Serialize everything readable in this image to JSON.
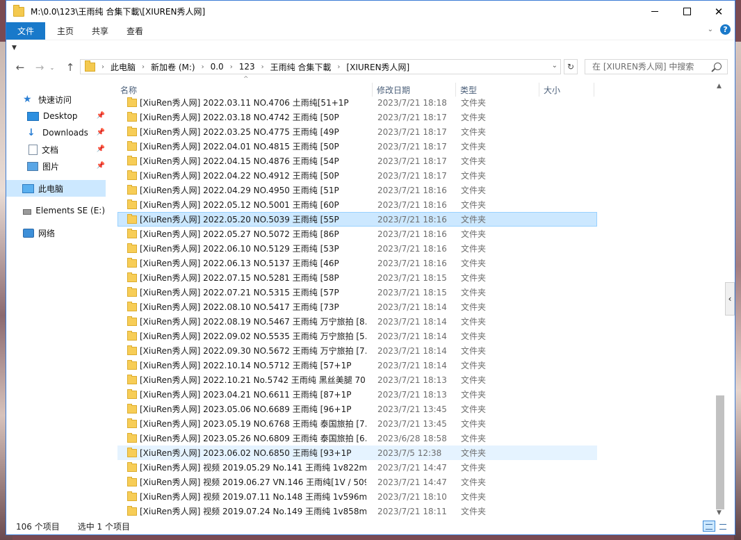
{
  "window": {
    "title": "M:\\0.0\\123\\王雨纯 合集下載\\[XIUREN秀人网]"
  },
  "ribbon": {
    "tabs": [
      "文件",
      "主页",
      "共享",
      "查看"
    ]
  },
  "address": {
    "crumbs": [
      "此电脑",
      "新加卷 (M:)",
      "0.0",
      "123",
      "王雨纯 合集下載",
      "[XIUREN秀人网]"
    ]
  },
  "search": {
    "placeholder": "在 [XIUREN秀人网] 中搜索"
  },
  "nav": {
    "items": [
      {
        "label": "快速访问",
        "icon": "star-icon",
        "pinned": false
      },
      {
        "label": "Desktop",
        "icon": "desktop-icon",
        "pinned": true
      },
      {
        "label": "Downloads",
        "icon": "download-icon",
        "pinned": true
      },
      {
        "label": "文档",
        "icon": "document-icon",
        "pinned": true
      },
      {
        "label": "图片",
        "icon": "picture-icon",
        "pinned": true
      },
      {
        "label": "此电脑",
        "icon": "computer-icon",
        "pinned": false
      },
      {
        "label": "Elements SE (E:)",
        "icon": "drive-icon",
        "pinned": false
      },
      {
        "label": "网络",
        "icon": "network-icon",
        "pinned": false
      }
    ]
  },
  "columns": {
    "name": "名称",
    "date": "修改日期",
    "type": "类型",
    "size": "大小"
  },
  "files": [
    {
      "name": "[XiuRen秀人网] 2022.03.11 NO.4706 土雨纯[51+1P",
      "date": "2023/7/21 18:18",
      "type": "文件夹"
    },
    {
      "name": "[XiuRen秀人网] 2022.03.18 NO.4742 王雨纯 [50P",
      "date": "2023/7/21 18:17",
      "type": "文件夹"
    },
    {
      "name": "[XiuRen秀人网] 2022.03.25 NO.4775 王雨纯 [49P",
      "date": "2023/7/21 18:17",
      "type": "文件夹"
    },
    {
      "name": "[XiuRen秀人网] 2022.04.01 NO.4815 王雨纯 [50P",
      "date": "2023/7/21 18:17",
      "type": "文件夹"
    },
    {
      "name": "[XiuRen秀人网] 2022.04.15 NO.4876 王雨纯 [54P",
      "date": "2023/7/21 18:17",
      "type": "文件夹"
    },
    {
      "name": "[XiuRen秀人网] 2022.04.22 NO.4912 王雨纯 [50P",
      "date": "2023/7/21 18:17",
      "type": "文件夹"
    },
    {
      "name": "[XiuRen秀人网] 2022.04.29 NO.4950 王雨纯 [51P",
      "date": "2023/7/21 18:16",
      "type": "文件夹"
    },
    {
      "name": "[XiuRen秀人网] 2022.05.12 NO.5001 王雨纯 [60P",
      "date": "2023/7/21 18:16",
      "type": "文件夹"
    },
    {
      "name": "[XiuRen秀人网] 2022.05.20 NO.5039 王雨纯 [55P",
      "date": "2023/7/21 18:16",
      "type": "文件夹"
    },
    {
      "name": "[XiuRen秀人网] 2022.05.27 NO.5072 王雨纯 [86P",
      "date": "2023/7/21 18:16",
      "type": "文件夹"
    },
    {
      "name": "[XiuRen秀人网] 2022.06.10 NO.5129 王雨纯 [53P",
      "date": "2023/7/21 18:16",
      "type": "文件夹"
    },
    {
      "name": "[XiuRen秀人网] 2022.06.13 NO.5137 王雨纯 [46P",
      "date": "2023/7/21 18:16",
      "type": "文件夹"
    },
    {
      "name": "[XiuRen秀人网] 2022.07.15 NO.5281 王雨纯 [58P",
      "date": "2023/7/21 18:15",
      "type": "文件夹"
    },
    {
      "name": "[XiuRen秀人网] 2022.07.21 NO.5315 王雨纯 [57P",
      "date": "2023/7/21 18:15",
      "type": "文件夹"
    },
    {
      "name": "[XiuRen秀人网] 2022.08.10 NO.5417 王雨纯 [73P",
      "date": "2023/7/21 18:14",
      "type": "文件夹"
    },
    {
      "name": "[XiuRen秀人网] 2022.08.19 NO.5467 王雨纯 万宁旅拍 [8...",
      "date": "2023/7/21 18:14",
      "type": "文件夹"
    },
    {
      "name": "[XiuRen秀人网] 2022.09.02 NO.5535 王雨纯 万宁旅拍 [5...",
      "date": "2023/7/21 18:14",
      "type": "文件夹"
    },
    {
      "name": "[XiuRen秀人网] 2022.09.30 NO.5672 王雨纯 万宁旅拍 [7...",
      "date": "2023/7/21 18:14",
      "type": "文件夹"
    },
    {
      "name": "[XiuRen秀人网] 2022.10.14 NO.5712 王雨纯 [57+1P",
      "date": "2023/7/21 18:14",
      "type": "文件夹"
    },
    {
      "name": "[XiuRen秀人网] 2022.10.21 No.5742 王雨纯 黑丝美腿 70...",
      "date": "2023/7/21 18:13",
      "type": "文件夹"
    },
    {
      "name": "[XiuRen秀人网] 2023.04.21 NO.6611 王雨纯 [87+1P",
      "date": "2023/7/21 18:13",
      "type": "文件夹"
    },
    {
      "name": "[XiuRen秀人网] 2023.05.06 NO.6689 王雨纯 [96+1P",
      "date": "2023/7/21 13:45",
      "type": "文件夹"
    },
    {
      "name": "[XiuRen秀人网] 2023.05.19 NO.6768 王雨纯 泰国旅拍 [7...",
      "date": "2023/7/21 13:45",
      "type": "文件夹"
    },
    {
      "name": "[XiuRen秀人网] 2023.05.26 NO.6809 王雨纯 泰国旅拍 [6...",
      "date": "2023/6/28 18:58",
      "type": "文件夹"
    },
    {
      "name": "[XiuRen秀人网] 2023.06.02 NO.6850 王雨纯 [93+1P",
      "date": "2023/7/5 12:38",
      "type": "文件夹"
    },
    {
      "name": "[XiuRen秀人网] 视频 2019.05.29 No.141 王雨纯 1v822m",
      "date": "2023/7/21 14:47",
      "type": "文件夹"
    },
    {
      "name": "[XiuRen秀人网] 视频 2019.06.27 VN.146 王雨纯[1V / 509...",
      "date": "2023/7/21 14:47",
      "type": "文件夹"
    },
    {
      "name": "[XiuRen秀人网] 视频 2019.07.11 No.148 王雨纯 1v596m",
      "date": "2023/7/21 18:10",
      "type": "文件夹"
    },
    {
      "name": "[XiuRen秀人网] 视频 2019.07.24 No.149 王雨纯 1v858m",
      "date": "2023/7/21 18:11",
      "type": "文件夹"
    }
  ],
  "selected_index": 8,
  "hover_index": 24,
  "status": {
    "count": "106 个项目",
    "selected": "选中 1 个项目"
  },
  "colors": {
    "accent": "#1979ca",
    "selection": "#cce8ff",
    "hover": "#e5f3ff"
  }
}
